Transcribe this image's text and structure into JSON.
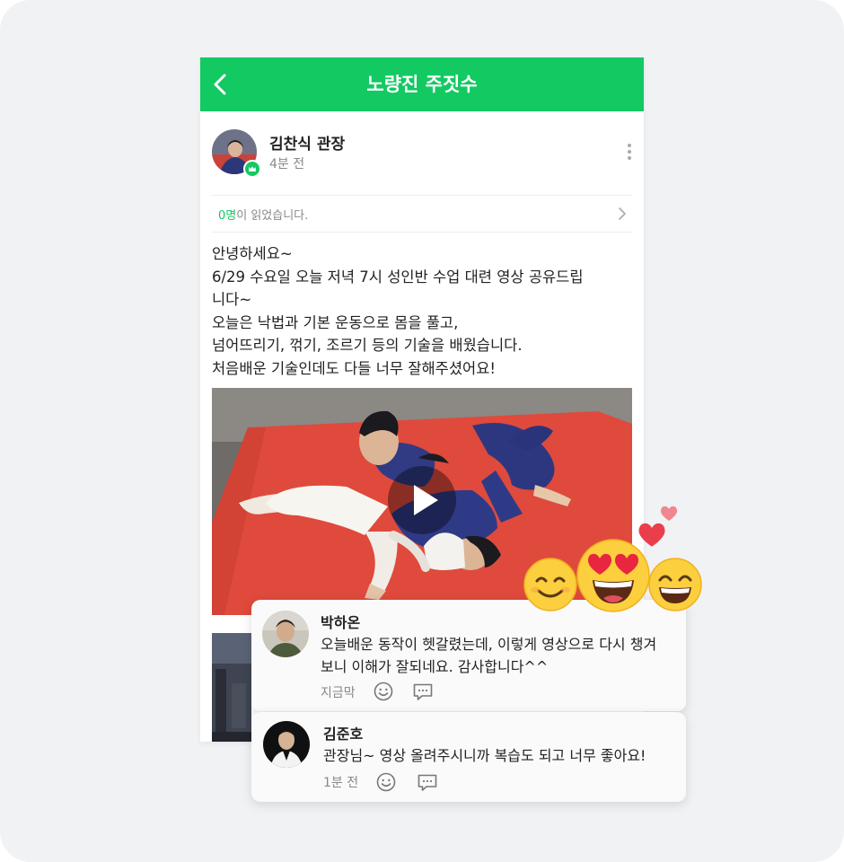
{
  "app": {
    "title": "노량진 주짓수"
  },
  "post": {
    "author": "김찬식 관장",
    "time": "4분 전",
    "read_count": "0명",
    "read_suffix": "이 읽었습니다.",
    "lines": [
      "안녕하세요~",
      "6/29 수요일 오늘 저녁 7시 성인반 수업 대련 영상 공유드립",
      "니다~",
      "오늘은 낙법과 기본 운동으로 몸을 풀고,",
      "넘어뜨리기, 꺾기, 조르기 등의 기술을 배웠습니다.",
      "처음배운 기술인데도 다들 너무 잘해주셨어요!"
    ]
  },
  "comments": [
    {
      "name": "박하온",
      "lines": [
        "오늘배운 동작이 헷갈렸는데, 이렇게 영상으로 다시 챙겨",
        "보니 이해가 잘되네요. 감사합니다^^"
      ],
      "time": "지금막"
    },
    {
      "name": "김준호",
      "lines": [
        "관장님~ 영상 올려주시니까 복습도 되고 너무 좋아요!"
      ],
      "time": "1분 전"
    }
  ],
  "icons": {
    "back": "chevron-left-icon",
    "more": "more-vertical-icon",
    "crown": "crown-icon",
    "chevron": "chevron-right-icon",
    "play": "play-icon",
    "smile": "smile-icon",
    "reply": "comment-icon"
  },
  "colors": {
    "brand": "#13c962",
    "mat": "#df4a3c",
    "gi": "#2f3a86"
  }
}
